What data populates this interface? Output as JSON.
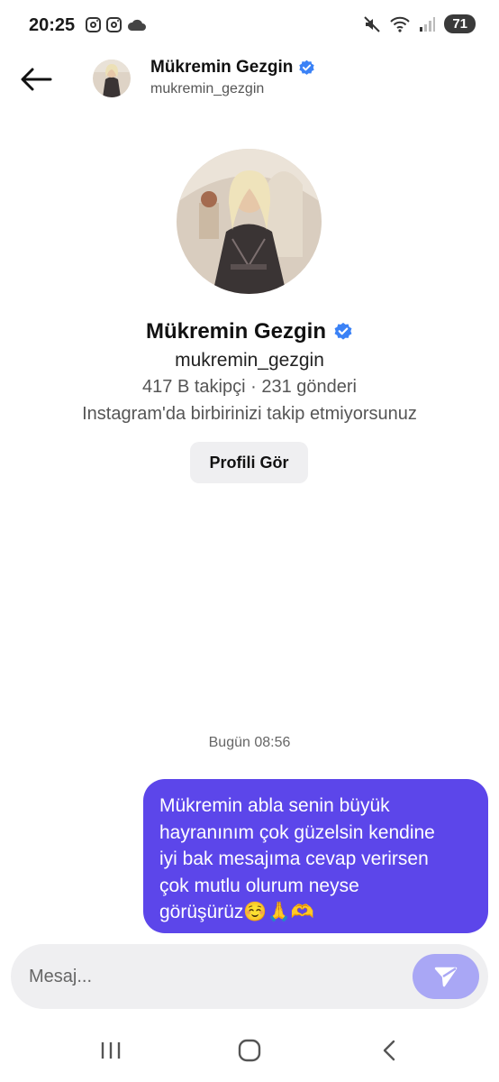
{
  "status_bar": {
    "time": "20:25",
    "battery": "71",
    "icons": [
      "instagram-icon",
      "instagram-icon",
      "cloud-icon",
      "mute-icon",
      "wifi-icon",
      "signal-icon",
      "battery-icon"
    ]
  },
  "header": {
    "name": "Mükremin Gezgin",
    "username": "mukremin_gezgin",
    "verified": true
  },
  "profile": {
    "name": "Mükremin Gezgin",
    "username": "mukremin_gezgin",
    "stats": "417 B takipçi · 231 gönderi",
    "follow_note": "Instagram'da birbirinizi takip etmiyorsunuz",
    "view_profile_label": "Profili Gör"
  },
  "conversation": {
    "timestamp": "Bugün 08:56",
    "messages": [
      {
        "sender": "me",
        "text": "Mükremin abla senin büyük\nhayranınım çok güzelsin kendine\niyi bak mesajıma cevap verirsen\nçok mutlu olurum neyse\ngörüşürüz☺️🙏🫶"
      }
    ]
  },
  "composer": {
    "placeholder": "Mesaj..."
  },
  "colors": {
    "accent": "#5c46ea",
    "send_button": "#a9a7f5",
    "verified_badge": "#3b82f6"
  }
}
